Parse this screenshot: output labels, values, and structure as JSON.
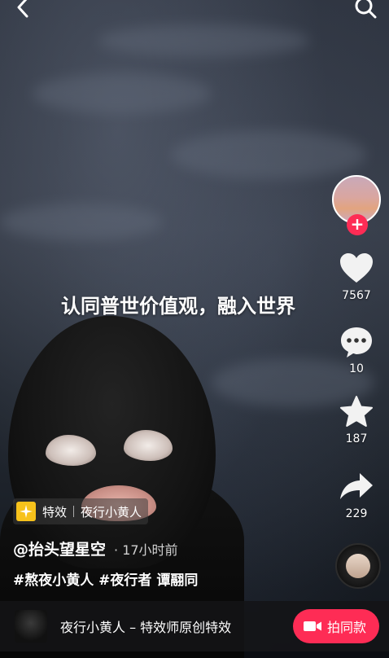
{
  "caption": "认同普世价值观，融入世界",
  "side_actions": {
    "like_count": "7567",
    "comment_count": "10",
    "favorite_count": "187",
    "share_count": "229"
  },
  "effect_tag": {
    "label": "特效",
    "name": "夜行小黄人"
  },
  "author": {
    "handle": "@抬头望星空",
    "time": "· 17小时前"
  },
  "hashtags": "#熬夜小黄人 #夜行者 谭翮同",
  "bottom_bar": {
    "title": "夜行小黄人 – 特效师原创特效",
    "shoot_label": "拍同款"
  },
  "colors": {
    "accent": "#fe2c55",
    "effect_icon": "#f7c21b"
  },
  "icons": [
    "back-icon",
    "search-icon",
    "follow-plus-icon",
    "heart-icon",
    "comment-icon",
    "star-icon",
    "share-icon",
    "camera-icon",
    "effect-sparkle-icon"
  ]
}
